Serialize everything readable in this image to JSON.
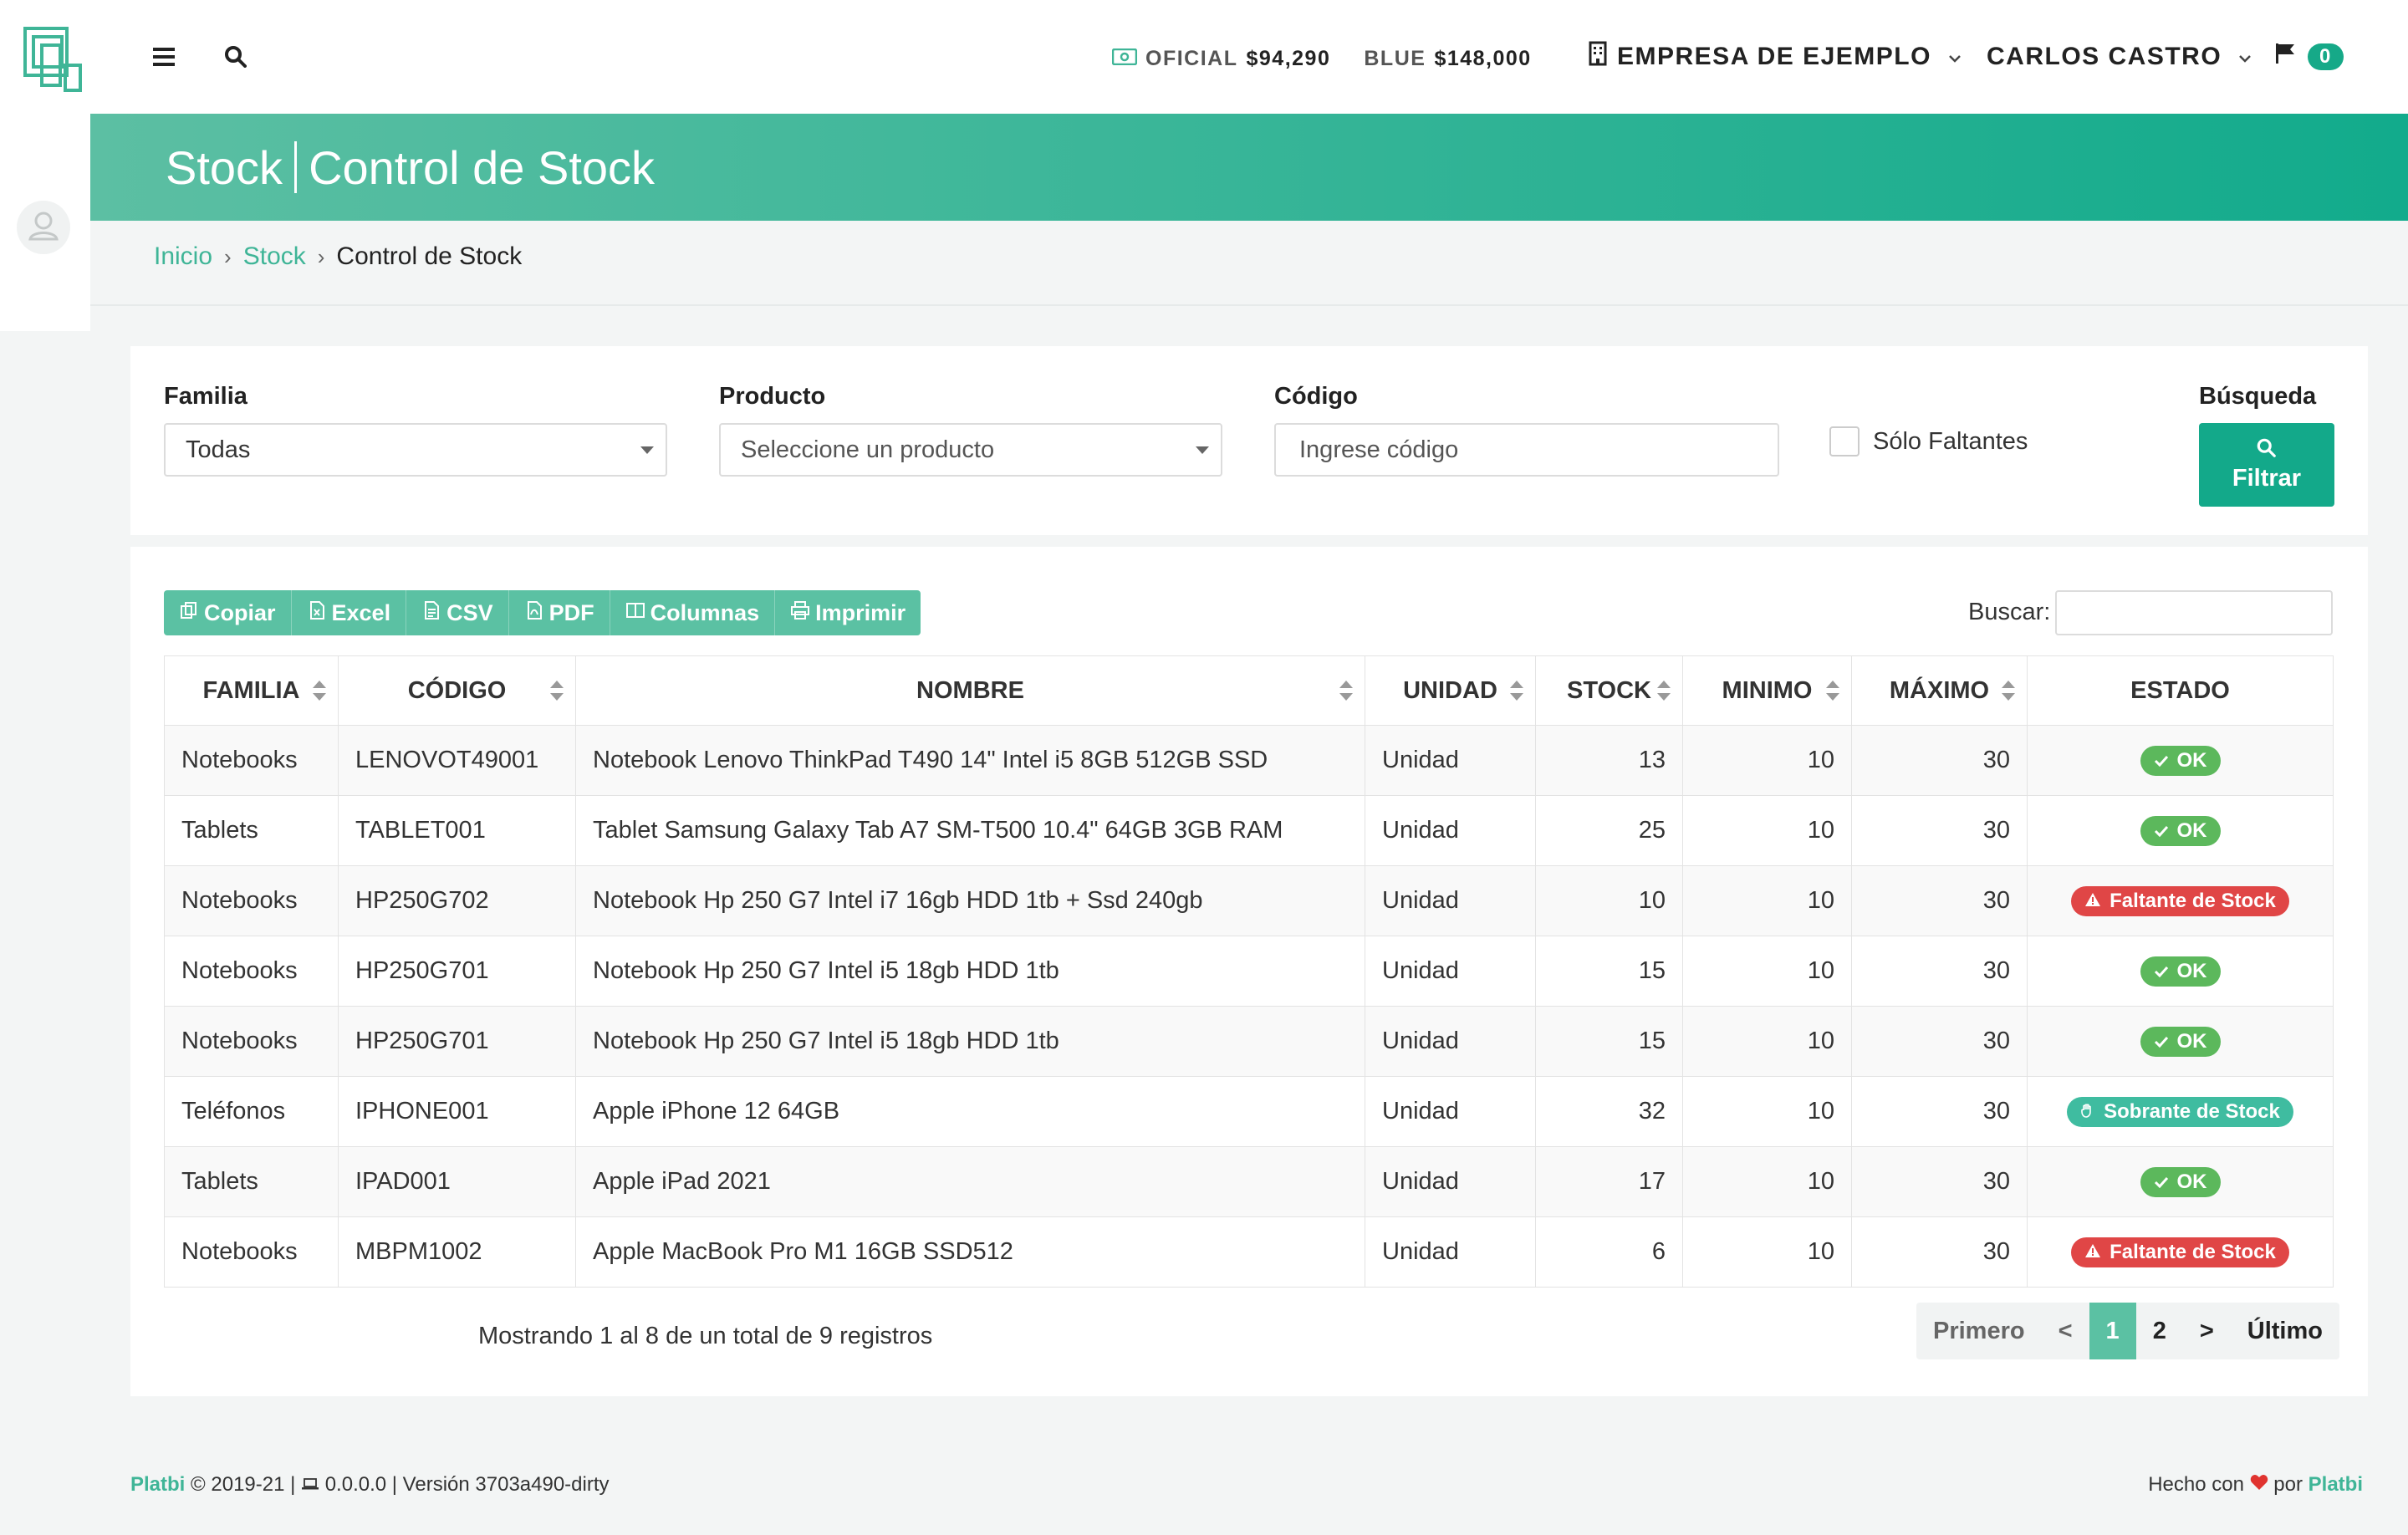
{
  "topbar": {
    "rates": [
      {
        "label": "OFICIAL",
        "value": "$94,290"
      },
      {
        "label": "BLUE",
        "value": "$148,000"
      }
    ],
    "company": "EMPRESA DE EJEMPLO",
    "user": "CARLOS CASTRO",
    "notifications": "0"
  },
  "header": {
    "section": "Stock",
    "title": "Control de Stock"
  },
  "breadcrumb": [
    "Inicio",
    "Stock",
    "Control de Stock"
  ],
  "filters": {
    "familia_label": "Familia",
    "familia_value": "Todas",
    "producto_label": "Producto",
    "producto_placeholder": "Seleccione un producto",
    "codigo_label": "Código",
    "codigo_placeholder": "Ingrese código",
    "solo_faltantes_label": "Sólo Faltantes",
    "busqueda_label": "Búsqueda",
    "filter_button": "Filtrar"
  },
  "toolbar": {
    "copiar": "Copiar",
    "excel": "Excel",
    "csv": "CSV",
    "pdf": "PDF",
    "columnas": "Columnas",
    "imprimir": "Imprimir",
    "search_label": "Buscar:"
  },
  "table": {
    "headers": [
      "FAMILIA",
      "CÓDIGO",
      "NOMBRE",
      "UNIDAD",
      "STOCK",
      "MINIMO",
      "MÁXIMO",
      "ESTADO"
    ],
    "rows": [
      {
        "familia": "Notebooks",
        "codigo": "LENOVOT49001",
        "nombre": "Notebook Lenovo ThinkPad T490 14\" Intel i5 8GB 512GB SSD",
        "unidad": "Unidad",
        "stock": "13",
        "minimo": "10",
        "maximo": "30",
        "estado": "OK"
      },
      {
        "familia": "Tablets",
        "codigo": "TABLET001",
        "nombre": "Tablet Samsung Galaxy Tab A7 SM-T500 10.4\" 64GB 3GB RAM",
        "unidad": "Unidad",
        "stock": "25",
        "minimo": "10",
        "maximo": "30",
        "estado": "OK"
      },
      {
        "familia": "Notebooks",
        "codigo": "HP250G702",
        "nombre": "Notebook Hp 250 G7 Intel i7 16gb HDD 1tb + Ssd 240gb",
        "unidad": "Unidad",
        "stock": "10",
        "minimo": "10",
        "maximo": "30",
        "estado": "Faltante de Stock"
      },
      {
        "familia": "Notebooks",
        "codigo": "HP250G701",
        "nombre": "Notebook Hp 250 G7 Intel i5 18gb HDD 1tb",
        "unidad": "Unidad",
        "stock": "15",
        "minimo": "10",
        "maximo": "30",
        "estado": "OK"
      },
      {
        "familia": "Notebooks",
        "codigo": "HP250G701",
        "nombre": "Notebook Hp 250 G7 Intel i5 18gb HDD 1tb",
        "unidad": "Unidad",
        "stock": "15",
        "minimo": "10",
        "maximo": "30",
        "estado": "OK"
      },
      {
        "familia": "Teléfonos",
        "codigo": "IPHONE001",
        "nombre": "Apple iPhone 12 64GB",
        "unidad": "Unidad",
        "stock": "32",
        "minimo": "10",
        "maximo": "30",
        "estado": "Sobrante de Stock"
      },
      {
        "familia": "Tablets",
        "codigo": "IPAD001",
        "nombre": "Apple iPad 2021",
        "unidad": "Unidad",
        "stock": "17",
        "minimo": "10",
        "maximo": "30",
        "estado": "OK"
      },
      {
        "familia": "Notebooks",
        "codigo": "MBPM1002",
        "nombre": "Apple MacBook Pro M1 16GB SSD512",
        "unidad": "Unidad",
        "stock": "6",
        "minimo": "10",
        "maximo": "30",
        "estado": "Faltante de Stock"
      }
    ],
    "info": "Mostrando 1 al 8 de un total de 9 registros"
  },
  "pagination": {
    "first": "Primero",
    "prev": "<",
    "pages": [
      "1",
      "2"
    ],
    "current": "1",
    "next": ">",
    "last": "Último"
  },
  "footer": {
    "brand": "Platbi",
    "copyright": "© 2019-21 |",
    "ip": "0.0.0.0",
    "version": "| Versión 3703a490-dirty",
    "made_with": "Hecho con",
    "by": "por",
    "maker": "Platbi"
  },
  "colors": {
    "accent": "#13a98a",
    "ok": "#5cb85c",
    "faltante": "#e04646",
    "sobrante": "#3fbca0"
  }
}
